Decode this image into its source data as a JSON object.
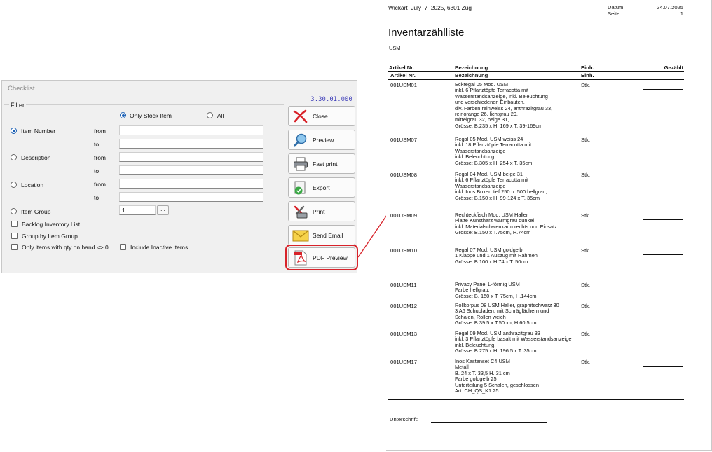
{
  "dialog": {
    "title": "Checklist",
    "version": "3.30.01.000",
    "filter_label": "Filter",
    "stock_options": [
      {
        "label": "Only Stock Item",
        "selected": true
      },
      {
        "label": "All",
        "selected": false
      }
    ],
    "ranges": [
      {
        "label": "Item Number",
        "selected": true,
        "from_label": "from",
        "to_label": "to",
        "from_value": "",
        "to_value": ""
      },
      {
        "label": "Description",
        "selected": false,
        "from_label": "from",
        "to_label": "to",
        "from_value": "",
        "to_value": ""
      },
      {
        "label": "Location",
        "selected": false,
        "from_label": "from",
        "to_label": "to",
        "from_value": "",
        "to_value": ""
      }
    ],
    "item_group": {
      "label": "Item Group",
      "value": "1",
      "browse_label": "..."
    },
    "checkboxes": {
      "backlog": "Backlog Inventory List",
      "group_by": "Group by Item Group",
      "qty_nonzero": "Only items with qty on hand <> 0",
      "include_inactive": "Include Inactive Items"
    },
    "buttons": {
      "close": "Close",
      "preview": "Preview",
      "fast_print": "Fast print",
      "export": "Export",
      "print": "Print",
      "send_email": "Send Email",
      "pdf_preview": "PDF Preview"
    },
    "highlight_color": "#d8232a"
  },
  "report": {
    "company": "Wickart_July_7_2025, 6301 Zug",
    "date_label": "Datum:",
    "date_value": "24.07.2025",
    "page_label": "Seite:",
    "page_value": "1",
    "title": "Inventarzählliste",
    "group": "USM",
    "columns": {
      "article": "Artikel Nr.",
      "desc": "Bezeichnung",
      "unit": "Einh.",
      "counted": "Gezählt"
    },
    "items": [
      {
        "no": "001USM01",
        "unit": "Stk.",
        "desc": [
          "Eckregal 05 Mod. USM",
          "inkl. 6 Pflanztöpfe Terracotta mit",
          "Wasserstandsanzeige, inkl. Beleuchtung",
          "und verschiedenen Einbauten,",
          "div. Farben reinweiss 24, anthrazitgrau 33,",
          "reinorange 26, lichtgrau 29,",
          "mittelgrau 32, beige 31,",
          "Grösse: B.235 x H. 169 x T. 39-169cm"
        ]
      },
      {
        "no": "001USM07",
        "unit": "Stk.",
        "desc": [
          "Regal 05 Mod. USM weiss 24",
          "inkl. 18 Pflanztöpfe Terracotta mit",
          "Wasserstandsanzeige",
          "inkl. Beleuchtung,",
          "Grösse: B.305 x H. 254 x T. 35cm"
        ]
      },
      {
        "no": "001USM08",
        "unit": "Stk.",
        "desc": [
          "Regal 04 Mod. USM beige 31",
          "inkl. 6 Pflanztöpfe Terracotta mit",
          "Wasserstandsanzeige",
          "inkl. Inos Boxen tief 250 u. 500 hellgrau,",
          "Grösse: B.150 x H. 99-124 x T. 35cm"
        ]
      },
      {
        "no": "001USM09",
        "unit": "Stk.",
        "desc": [
          "Rechteckfisch Mod. USM Haller",
          "Platte Kunstharz warmgrau dunkel",
          "inkl. Materialschwenkarm rechts und Einsatz",
          "Grösse: B.150 x T.75cm, H.74cm"
        ]
      },
      {
        "no": "001USM10",
        "unit": "Stk.",
        "desc": [
          "Regal 07 Mod. USM goldgelb",
          "1 Klappe und 1 Auszug mit Rahmen",
          "Grösse: B.100 x H.74 x T. 50cm"
        ]
      },
      {
        "no": "001USM11",
        "unit": "Stk.",
        "desc": [
          "Privacy Panel L-förmig USM",
          "Farbe hellgrau,",
          "Grösse: B. 150 x T. 75cm, H.144cm"
        ]
      },
      {
        "no": "001USM12",
        "unit": "Stk.",
        "desc": [
          "Rollkorpus 08 USM Haller, graphitschwarz 30",
          "3 A6 Schubladen, mit Schrägfächern und",
          "Schalen, Rollen weich",
          "Grösse: B.39.5 x T.50cm, H.60.5cm"
        ]
      },
      {
        "no": "001USM13",
        "unit": "Stk.",
        "desc": [
          "Regal 09 Mod. USM anthrazitgrau 33",
          "inkl. 3 Pflanztöpfe basalt mit Wasserstandsanzeige",
          "inkl. Beleuchtung,",
          "Grösse: B.275 x H. 196.5 x T. 35cm"
        ]
      },
      {
        "no": "001USM17",
        "unit": "Stk.",
        "desc": [
          "Inos Kastenset C4 USM",
          "Metall",
          "B. 24 x T. 33,5 H. 31 cm",
          "Farbe goldgelb 25",
          "Unterteilung 5 Schalen, geschlossen",
          "Art. CH_QS_K1.25"
        ]
      }
    ],
    "signature_label": "Unterschrift:"
  }
}
